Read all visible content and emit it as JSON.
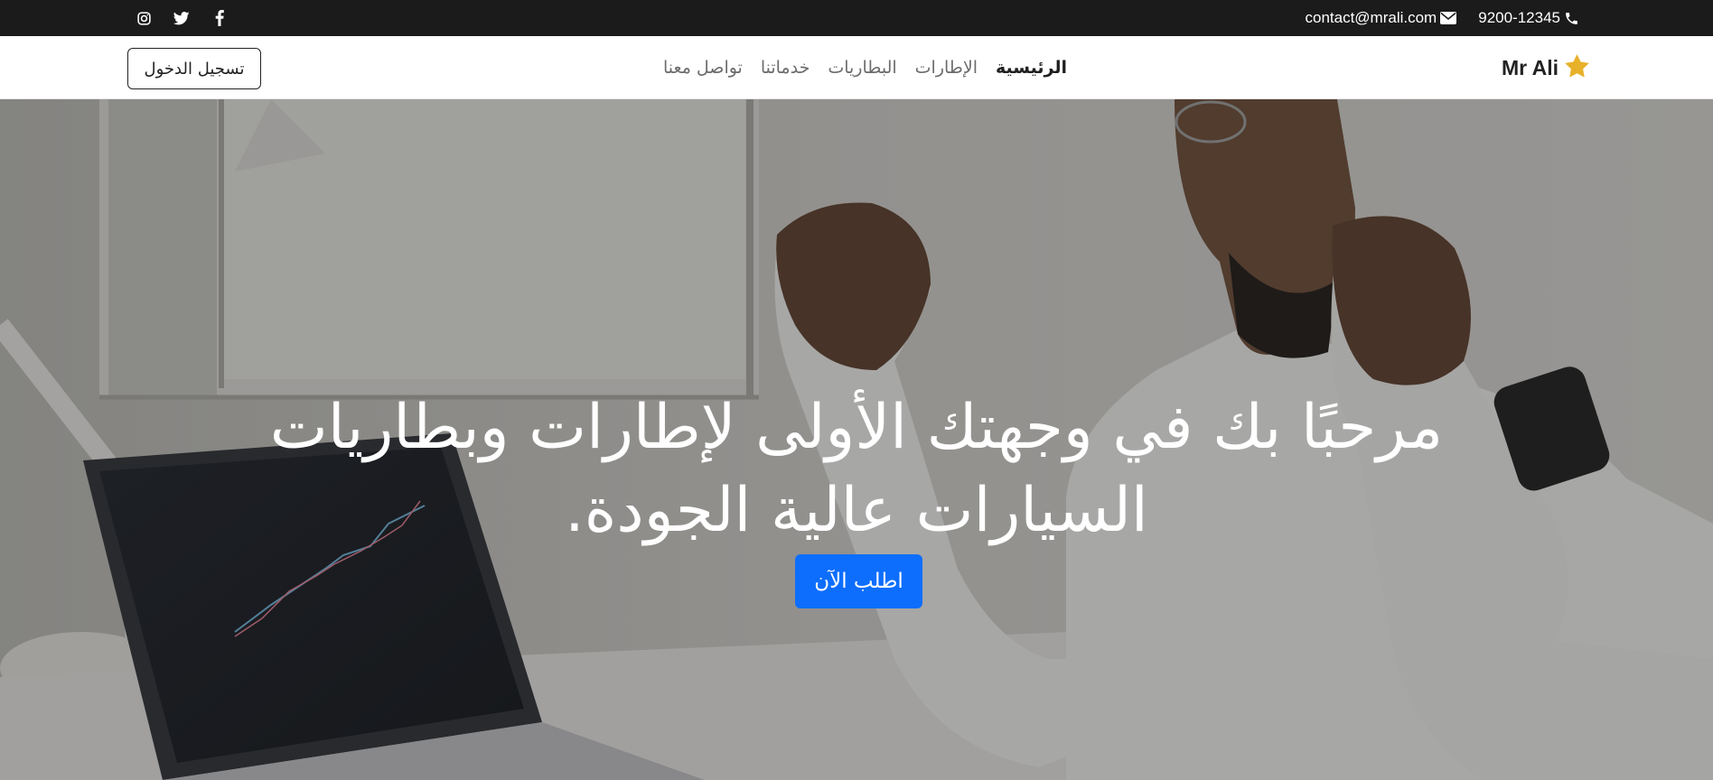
{
  "topbar": {
    "phone": "9200-12345",
    "email": "contact@mrali.com",
    "social_icons": [
      "instagram-icon",
      "twitter-icon",
      "facebook-icon"
    ]
  },
  "navbar": {
    "brand": "Mr Ali",
    "brand_icon": "star-icon",
    "links": [
      {
        "label": "الرئيسية",
        "active": true
      },
      {
        "label": "الإطارات",
        "active": false
      },
      {
        "label": "البطاريات",
        "active": false
      },
      {
        "label": "خدماتنا",
        "active": false
      },
      {
        "label": "تواصل معنا",
        "active": false
      }
    ],
    "login_label": "تسجيل الدخول"
  },
  "hero": {
    "title": "مرحبًا بك في وجهتك الأولى لإطارات وبطاريات السيارات عالية الجودة.",
    "cta_label": "اطلب الآن"
  },
  "colors": {
    "topbar_bg": "#1b1b1b",
    "accent": "#0d6efd",
    "star": "#e8b12a"
  }
}
